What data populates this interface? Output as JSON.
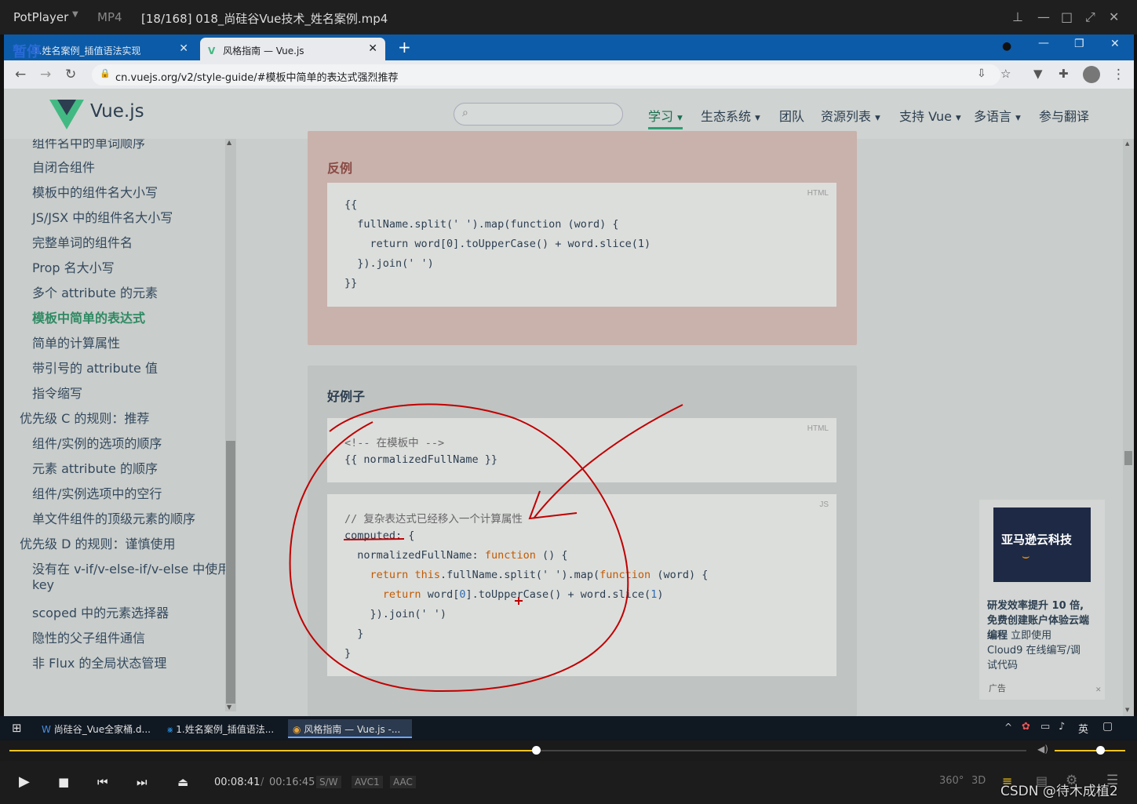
{
  "player": {
    "app_name": "PotPlayer",
    "format": "MP4",
    "title": "[18/168] 018_尚硅谷Vue技术_姓名案例.mp4",
    "state_label": "暂停",
    "time_current": "00:08:41",
    "time_separator": "/",
    "time_total": "00:16:45",
    "tags": [
      "S/W",
      "AVC1",
      "AAC"
    ],
    "btn_360": "360°",
    "btn_3d": "3D",
    "progress": 0.518
  },
  "browser": {
    "tabs": [
      {
        "label": "1.姓名案例_插值语法实现",
        "active": false
      },
      {
        "label": "风格指南 — Vue.js",
        "active": true
      }
    ],
    "new_tab": "+",
    "url": "cn.vuejs.org/v2/style-guide/#模板中简单的表达式强烈推荐"
  },
  "site": {
    "logo_text": "Vue.js",
    "nav": [
      {
        "label": "学习",
        "dropdown": true,
        "active": true
      },
      {
        "label": "生态系统",
        "dropdown": true
      },
      {
        "label": "团队"
      },
      {
        "label": "资源列表",
        "dropdown": true
      },
      {
        "label": "支持 Vue",
        "dropdown": true
      },
      {
        "label": "多语言",
        "dropdown": true
      },
      {
        "label": "参与翻译"
      }
    ]
  },
  "sidebar": {
    "items": [
      {
        "label": "组件名中的单词顺序",
        "level": "sub"
      },
      {
        "label": "自闭合组件",
        "level": "sub"
      },
      {
        "label": "模板中的组件名大小写",
        "level": "sub"
      },
      {
        "label": "JS/JSX 中的组件名大小写",
        "level": "sub"
      },
      {
        "label": "完整单词的组件名",
        "level": "sub"
      },
      {
        "label": "Prop 名大小写",
        "level": "sub"
      },
      {
        "label": "多个 attribute 的元素",
        "level": "sub"
      },
      {
        "label": "模板中简单的表达式",
        "level": "sub",
        "current": true
      },
      {
        "label": "简单的计算属性",
        "level": "sub"
      },
      {
        "label": "带引号的 attribute 值",
        "level": "sub"
      },
      {
        "label": "指令缩写",
        "level": "sub"
      },
      {
        "label": "优先级 C 的规则：推荐",
        "level": "top"
      },
      {
        "label": "组件/实例的选项的顺序",
        "level": "sub"
      },
      {
        "label": "元素 attribute 的顺序",
        "level": "sub"
      },
      {
        "label": "组件/实例选项中的空行",
        "level": "sub"
      },
      {
        "label": "单文件组件的顶级元素的顺序",
        "level": "sub"
      },
      {
        "label": "优先级 D 的规则：谨慎使用",
        "level": "top"
      },
      {
        "label": "没有在 v-if/v-else-if/v-else 中使用",
        "level": "sub"
      },
      {
        "label": "key",
        "level": "sub"
      },
      {
        "label": "scoped 中的元素选择器",
        "level": "sub"
      },
      {
        "label": "隐性的父子组件通信",
        "level": "sub"
      },
      {
        "label": "非 Flux 的全局状态管理",
        "level": "sub"
      }
    ]
  },
  "bad_example": {
    "heading": "反例",
    "lang": "HTML",
    "lines": [
      "{{",
      "  fullName.split(' ').map(function (word) {",
      "    return word[0].toUpperCase() + word.slice(1)",
      "  }).join(' ')",
      "}}"
    ]
  },
  "good_example": {
    "heading": "好例子",
    "html_lang": "HTML",
    "html_lines": [
      "<!-- 在模板中 -->",
      "{{ normalizedFullName }}"
    ],
    "js_lang": "JS",
    "js_comment": "// 复杂表达式已经移入一个计算属性",
    "js_computed": "computed: {",
    "js_lines": [
      "  normalizedFullName: function () {",
      "    return this.fullName.split(' ').map(function (word) {",
      "      return word[0].toUpperCase() + word.slice(1)",
      "    }).join(' ')",
      "  }",
      "}"
    ]
  },
  "ad": {
    "banner": "亚马逊云科技",
    "line1": "研发效率提升 10 倍,",
    "line2": "免费创建账户体验云端",
    "line3_bold": "编程",
    "line3_rest": " 立即使用",
    "line4": "Cloud9 在线编写/调",
    "line5": "试代码",
    "badge": "广告"
  },
  "taskbar": {
    "items": [
      "尚硅谷_Vue全家桶.d...",
      "1.姓名案例_插值语法...",
      "风格指南 — Vue.js -..."
    ],
    "ime": "英"
  },
  "watermark": "CSDN @待木成植2",
  "colors": {
    "annotation": "#c00000",
    "vue_green": "#42b983",
    "player_accent": "#f0c419"
  }
}
